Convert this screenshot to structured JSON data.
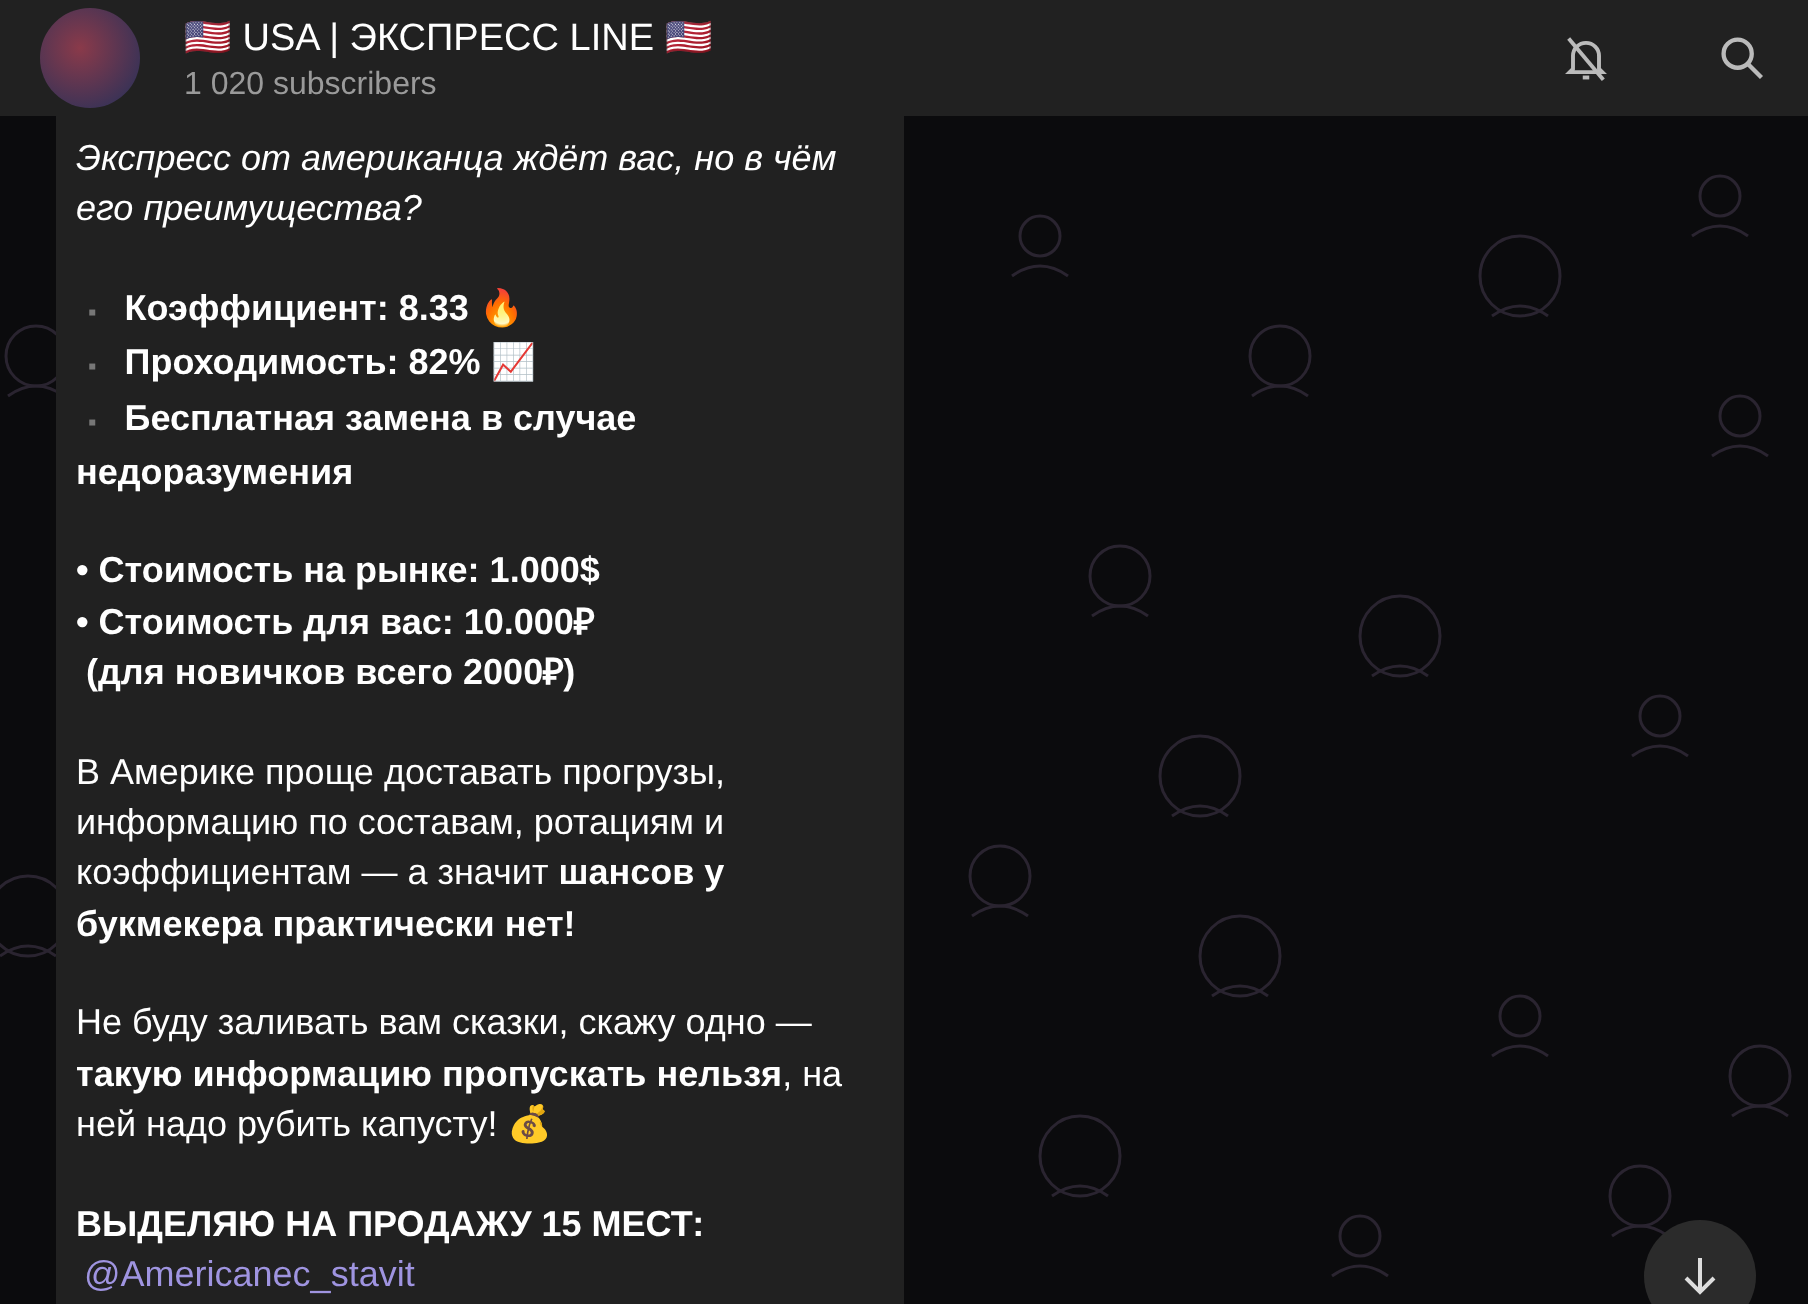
{
  "header": {
    "title": "🇺🇸  USA | ЭКСПРЕСС LINE 🇺🇸",
    "subtitle": "1 020 subscribers",
    "muted": true
  },
  "message": {
    "blocks": [
      {
        "kind": "italic",
        "text": "Экспресс от американца ждёт вас, но в чём его преимущества?"
      },
      {
        "kind": "list",
        "items": [
          {
            "marker": "▪",
            "text": "Коэффициент: 8.33 🔥"
          },
          {
            "marker": "▪",
            "text": "Проходимость: 82% 📈"
          },
          {
            "marker": "▪",
            "text": "Бесплатная замена в случае недоразумения"
          }
        ]
      },
      {
        "kind": "lines",
        "lines": [
          "• Стоимость на рынке: 1.000$",
          "• Стоимость для вас: 10.000₽",
          " (для новичков всего 2000₽)"
        ]
      },
      {
        "kind": "text",
        "text": "В Америке проще доставать прогрузы, информацию по составам, ротациям и коэффициентам — а значит **шансов у букмекера практически нет!**"
      },
      {
        "kind": "text",
        "text": "Не буду заливать вам сказки, скажу одно — **такую информацию пропускать нельзя**, на ней надо рубить капусту! 💰"
      },
      {
        "kind": "heading",
        "text": "ВЫДЕЛЯЮ НА ПРОДАЖУ 15 МЕСТ:",
        "link": "@Americanec_stavit"
      }
    ]
  }
}
